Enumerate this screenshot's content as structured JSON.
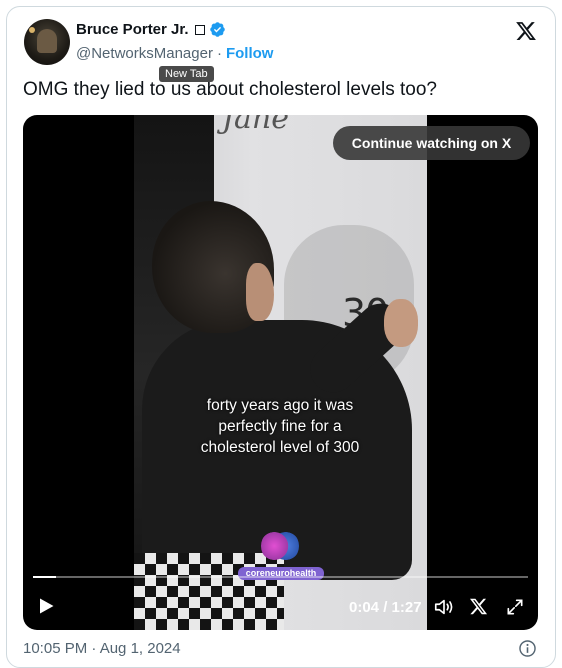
{
  "author": {
    "name": "Bruce Porter Jr.",
    "handle": "@NetworksManager",
    "separator": "·",
    "follow_label": "Follow"
  },
  "tooltip": "New Tab",
  "tweet": {
    "text": "OMG they lied to us about cholesterol levels too?",
    "timestamp": "10:05 PM · Aug 1, 2024"
  },
  "video": {
    "continue_label": "Continue watching on X",
    "caption_lines": [
      "forty years ago it was",
      "perfectly fine for a",
      "cholesterol level of 300"
    ],
    "board_text_top": "Jane",
    "board_number": "30",
    "watermark": "coreneurohealth",
    "time_display": "0:04 / 1:27",
    "progress_fraction": 0.046
  },
  "icons": {
    "verified": "verified-badge-icon",
    "x_logo": "x-logo-icon",
    "play": "play-icon",
    "volume": "volume-icon",
    "fullscreen": "fullscreen-icon",
    "info": "info-icon"
  },
  "colors": {
    "accent": "#1d9bf0",
    "text_primary": "#0f1419",
    "text_secondary": "#536471",
    "border": "#cfd9de"
  }
}
